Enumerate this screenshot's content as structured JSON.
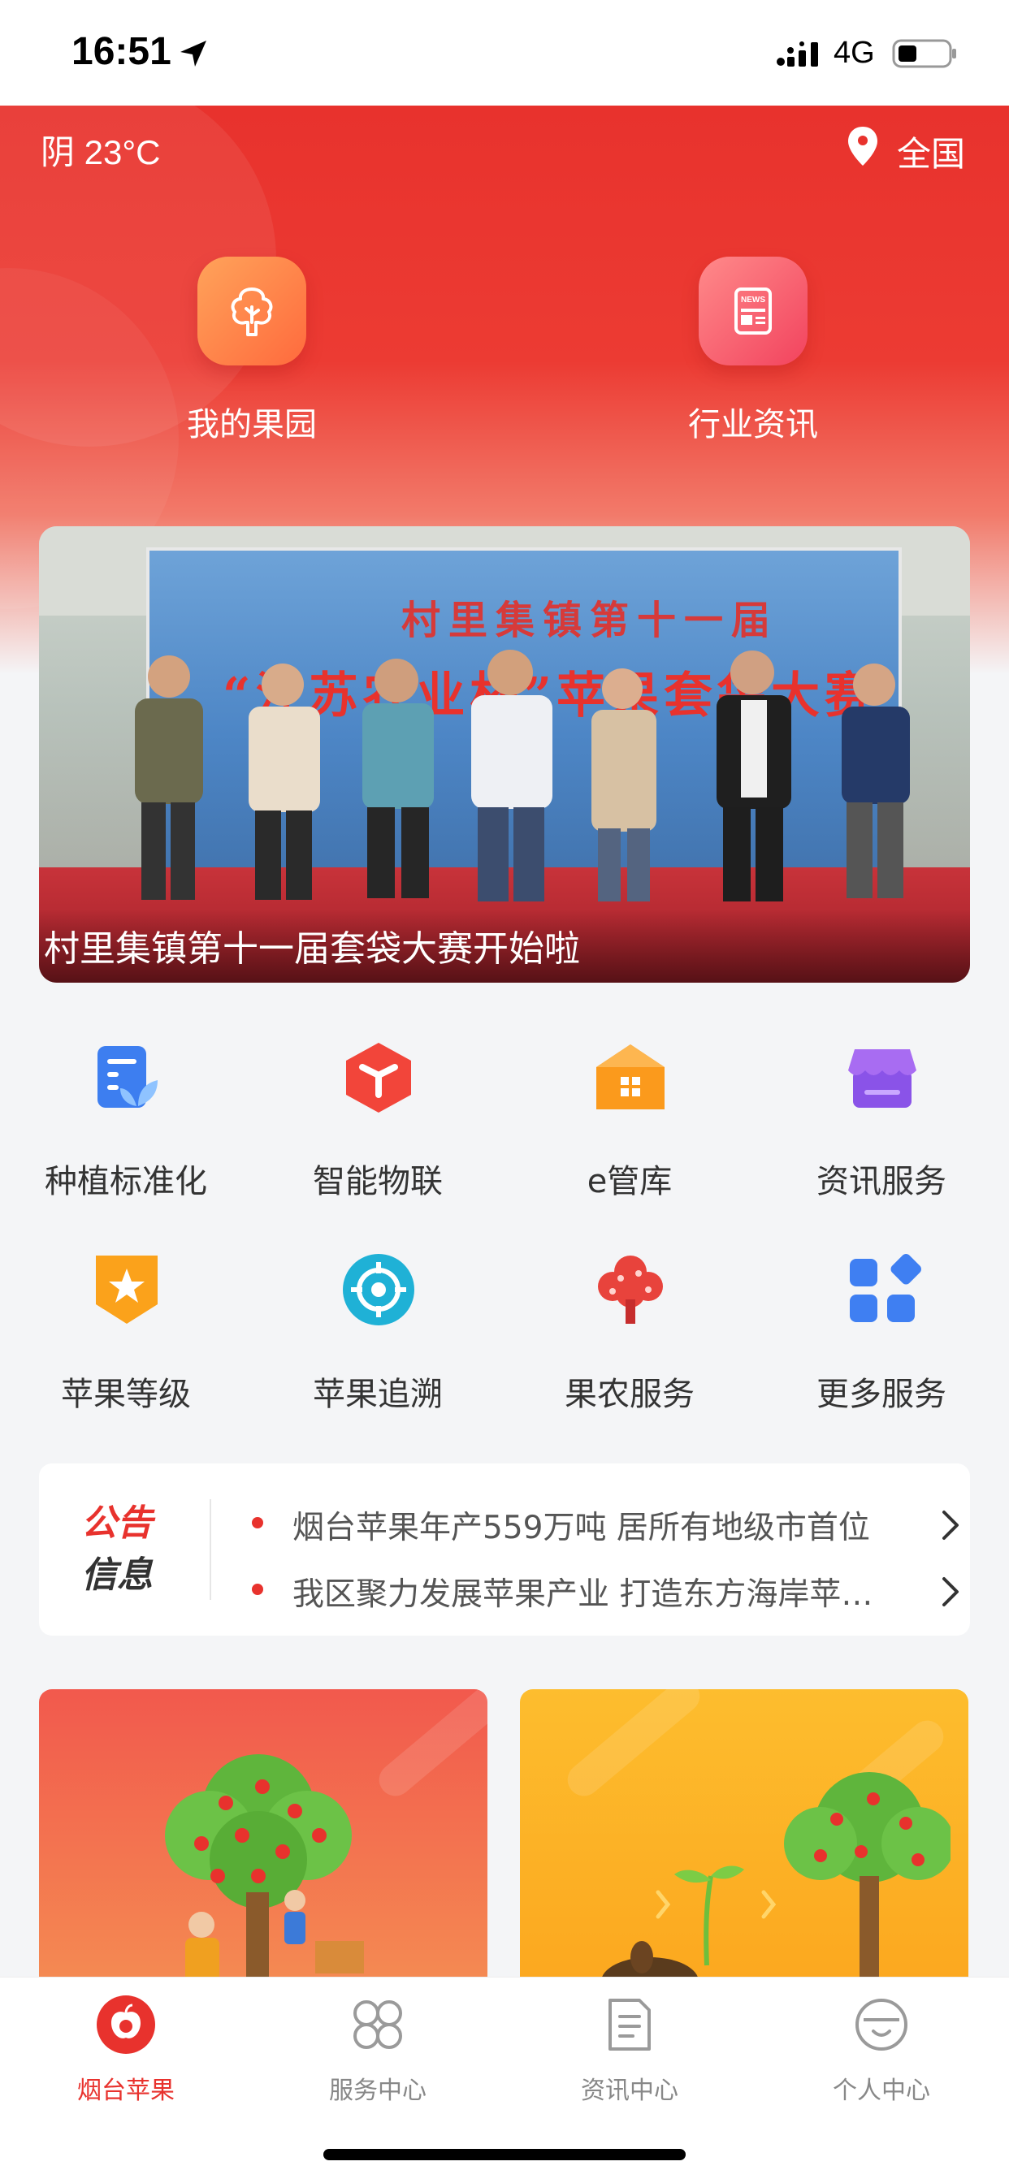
{
  "status_bar": {
    "time": "16:51",
    "network": "4G"
  },
  "header": {
    "weather": "阴 23°C",
    "location": "全国",
    "quick_links": [
      {
        "label": "我的果园",
        "icon": "tree-icon"
      },
      {
        "label": "行业资讯",
        "icon": "news-icon"
      }
    ]
  },
  "banner": {
    "caption": "村里集镇第十一届套袋大赛开始啦",
    "poster_title": "村里集镇第十一届",
    "poster_subtitle": "“江苏农业杯”苹果套袋大赛"
  },
  "services": [
    {
      "label": "种植标准化",
      "icon": "planting-standard-icon"
    },
    {
      "label": "智能物联",
      "icon": "iot-icon"
    },
    {
      "label": "e管库",
      "icon": "warehouse-icon"
    },
    {
      "label": "资讯服务",
      "icon": "info-service-icon"
    },
    {
      "label": "苹果等级",
      "icon": "apple-grade-icon"
    },
    {
      "label": "苹果追溯",
      "icon": "apple-trace-icon"
    },
    {
      "label": "果农服务",
      "icon": "farmer-service-icon"
    },
    {
      "label": "更多服务",
      "icon": "more-services-icon"
    }
  ],
  "notice": {
    "badge_line1": "公告",
    "badge_line2": "信息",
    "items": [
      "烟台苹果年产559万吨 居所有地级市首位",
      "我区聚力发展苹果产业 打造东方海岸苹果新名片"
    ]
  },
  "tabs": [
    {
      "label": "烟台苹果",
      "active": true
    },
    {
      "label": "服务中心",
      "active": false
    },
    {
      "label": "资讯中心",
      "active": false
    },
    {
      "label": "个人中心",
      "active": false
    }
  ],
  "colors": {
    "brand": "#e8322d",
    "header_top": "#e8322d",
    "promo_left": "#f2594d",
    "promo_right": "#fdbd2e"
  }
}
